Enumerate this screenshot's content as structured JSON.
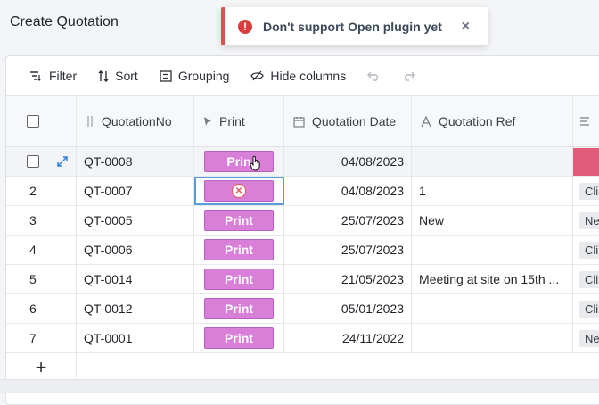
{
  "page": {
    "title": "Create Quotation"
  },
  "toast": {
    "message": "Don't support Open plugin yet",
    "icon": "error-icon",
    "close": "×"
  },
  "toolbar": {
    "filter": "Filter",
    "sort": "Sort",
    "grouping": "Grouping",
    "hide_columns": "Hide columns"
  },
  "columns": {
    "no": "QuotationNo",
    "print": "Print",
    "date": "Quotation Date",
    "ref": "Quotation Ref"
  },
  "print_label": "Print",
  "hover_print_label": "Prin",
  "rows": [
    {
      "index": "",
      "no": "QT-0008",
      "date": "04/08/2023",
      "ref": "",
      "tag": ""
    },
    {
      "index": "2",
      "no": "QT-0007",
      "date": "04/08/2023",
      "ref": "1",
      "tag": "Cli"
    },
    {
      "index": "3",
      "no": "QT-0005",
      "date": "25/07/2023",
      "ref": "New",
      "tag": "Ne"
    },
    {
      "index": "4",
      "no": "QT-0006",
      "date": "25/07/2023",
      "ref": "",
      "tag": "Cli"
    },
    {
      "index": "5",
      "no": "QT-0014",
      "date": "21/05/2023",
      "ref": "Meeting at site on 15th ...",
      "tag": "Cli"
    },
    {
      "index": "6",
      "no": "QT-0012",
      "date": "05/01/2023",
      "ref": "",
      "tag": "Cli"
    },
    {
      "index": "7",
      "no": "QT-0001",
      "date": "24/11/2022",
      "ref": "",
      "tag": "Ne"
    }
  ],
  "add_row": "+",
  "colors": {
    "accent_print": "#d87fd8",
    "error": "#d93d3d",
    "selection": "#5a9bd8",
    "tag_pink": "#e05d7a"
  }
}
